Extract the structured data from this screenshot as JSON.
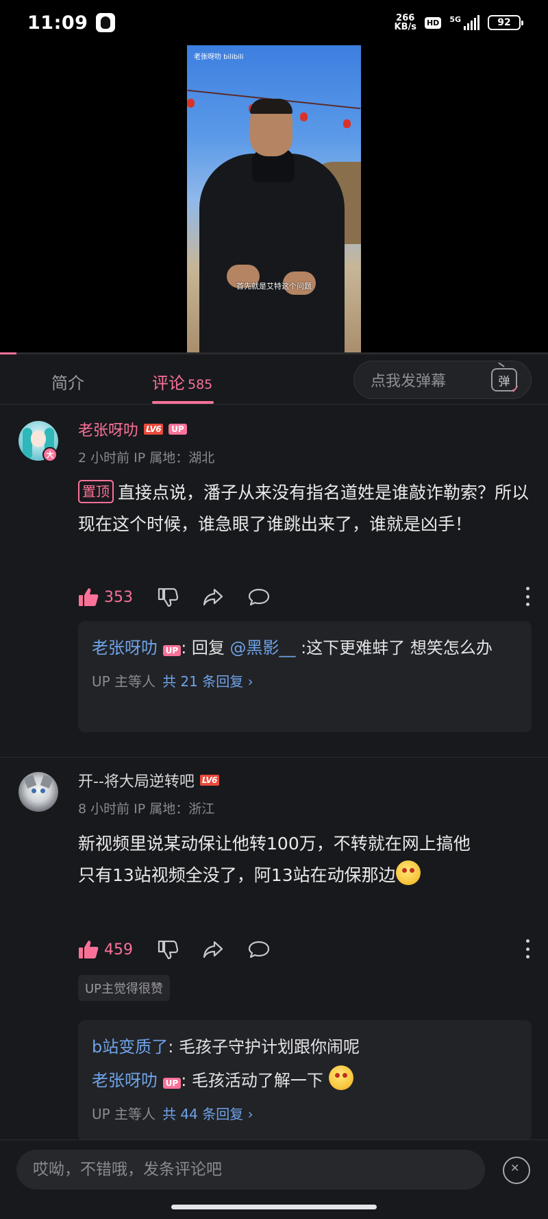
{
  "status_bar": {
    "time": "11:09",
    "net_speed": "266\nKB/s",
    "net_speed_top": "266",
    "net_speed_bottom": "KB/s",
    "hd": "HD",
    "network": "5G",
    "battery": "92"
  },
  "video": {
    "watermark": "老张呀叻 bilibili",
    "subtitle": "首先就是艾特这个问题",
    "progress": 0.03
  },
  "tabs": {
    "intro": "简介",
    "comments": "评论",
    "comments_count": "585"
  },
  "danmaku": {
    "placeholder": "点我发弹幕",
    "icon_label": "弹"
  },
  "comments": [
    {
      "username": "老张呀叻",
      "level": "LV6",
      "up_badge": "UP",
      "avatar_badge": "大",
      "meta": "2 小时前 IP 属地：湖北",
      "pinned_tag": "置顶",
      "text": "直接点说，潘子从来没有指名道姓是谁敲诈勒索？所以现在这个时候，谁急眼了谁跳出来了，谁就是凶手！",
      "likes": "353",
      "replies": [
        {
          "name": "老张呀叻",
          "up_badge": "UP",
          "prefix": ": 回复 ",
          "at": "@黑影__",
          "text": " :这下更难蚌了  想笑怎么办"
        }
      ],
      "reply_footer": {
        "who": "UP 主等人",
        "more": "共 21 条回复 ›"
      }
    },
    {
      "username": "开--将大局逆转吧",
      "level": "LV6",
      "meta": "8 小时前 IP 属地：浙江",
      "text_line1": "新视频里说某动保让他转100万，不转就在网上搞他",
      "text_line2": "只有13站视频全没了，阿13站在动保那边",
      "likes": "459",
      "up_liked": "UP主觉得很赞",
      "replies": [
        {
          "name": "b站变质了",
          "text": ": 毛孩子守护计划跟你闹呢"
        },
        {
          "name": "老张呀叻",
          "up_badge": "UP",
          "text": ": 毛孩活动了解一下"
        }
      ],
      "reply_footer": {
        "who": "UP 主等人",
        "more": "共 44 条回复 ›"
      }
    }
  ],
  "comment_input": {
    "placeholder": "哎呦，不错哦，发条评论吧"
  },
  "colors": {
    "accent": "#fb7299",
    "link": "#6fa3e8",
    "background": "#18191c"
  }
}
